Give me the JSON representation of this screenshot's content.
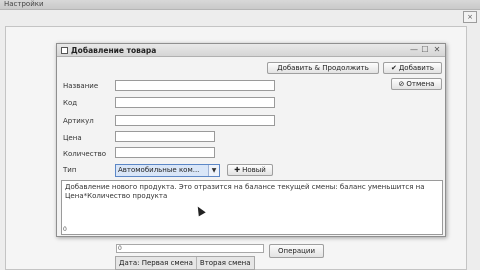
{
  "bg_window": {
    "title": "Настройки",
    "close_glyph": "×",
    "progress_text": "0",
    "operations_label": "Операции",
    "tabs": [
      "Дата: Первая смена",
      "Вторая смена"
    ]
  },
  "dialog": {
    "title": "Добавление товара",
    "minimize_glyph": "—",
    "maximize_glyph": "☐",
    "close_glyph": "✕",
    "add_continue_label": "Добавить & Продолжить",
    "add_label": "Добавить",
    "cancel_label": "Отмена",
    "fields": {
      "name": {
        "label": "Название",
        "value": ""
      },
      "code": {
        "label": "Код",
        "value": ""
      },
      "article": {
        "label": "Артикул",
        "value": ""
      },
      "price": {
        "label": "Цена",
        "value": ""
      },
      "quantity": {
        "label": "Количество",
        "value": ""
      },
      "type": {
        "label": "Тип",
        "value": "Автомобильные ком..."
      }
    },
    "new_type_label": "Новый",
    "description": "Добавление нового продукта. Это отразится на балансе текущей смены: баланс уменьшится на Цена*Количество продукта",
    "description_corner": "0"
  },
  "icons": {
    "check": "check-icon",
    "cancel": "cancel-circle-icon",
    "plus": "plus-icon",
    "dropdown": "chevron-down-icon"
  }
}
